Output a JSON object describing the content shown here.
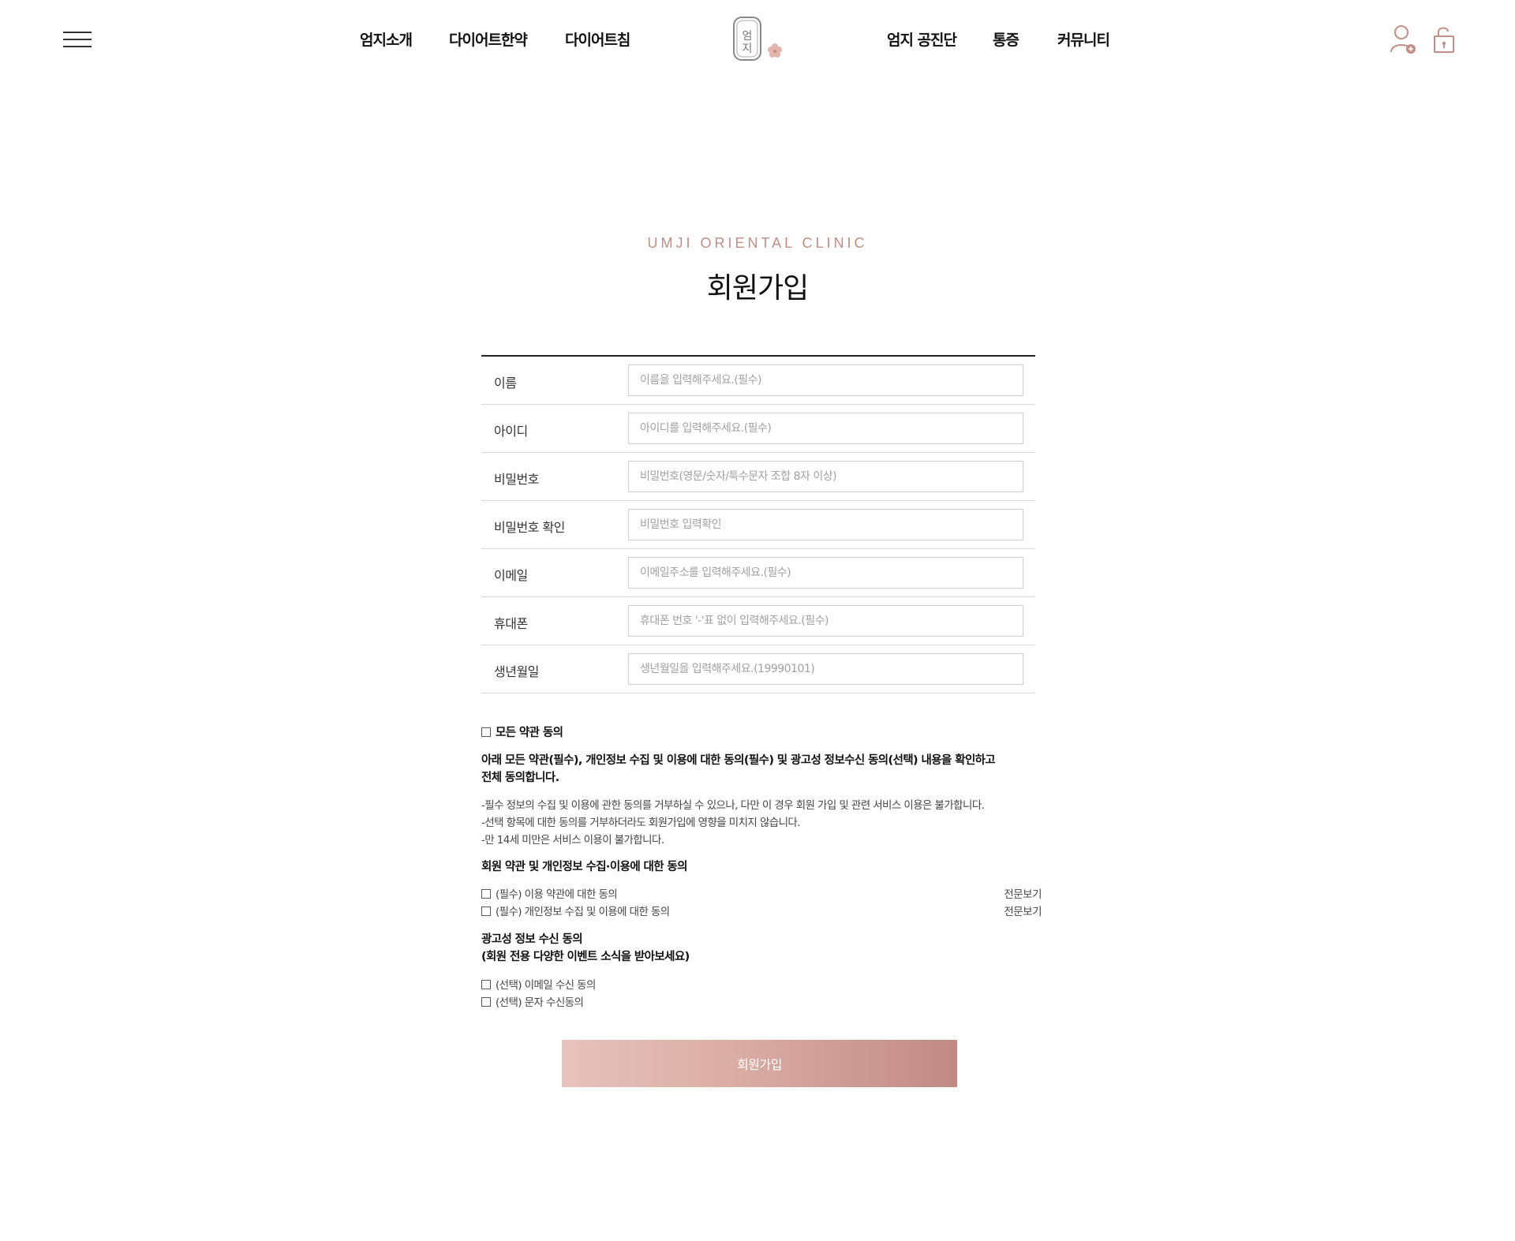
{
  "nav": {
    "left_items": [
      "엄지소개",
      "다이어트한약",
      "다이어트침"
    ],
    "right_items": [
      "엄지 공진단",
      "통증",
      "커뮤니티"
    ],
    "logo_text": "엄지"
  },
  "icons": {
    "menu": "hamburger-menu-icon",
    "join": "user-add-icon",
    "login": "lock-icon",
    "accent_color": "#c28e86"
  },
  "page": {
    "subtitle": "UMJI ORIENTAL CLINIC",
    "title": "회원가입"
  },
  "form": {
    "fields": [
      {
        "label": "이름",
        "placeholder": "이름을 입력해주세요.(필수)"
      },
      {
        "label": "아이디",
        "placeholder": "아이디를 입력해주세요.(필수)"
      },
      {
        "label": "비밀번호",
        "placeholder": "비밀번호(영문/숫자/특수문자 조합 8자 이상)"
      },
      {
        "label": "비밀번호 확인",
        "placeholder": "비밀번호 입력확인"
      },
      {
        "label": "이메일",
        "placeholder": "이메일주소를 입력해주세요.(필수)"
      },
      {
        "label": "휴대폰",
        "placeholder": "휴대폰 번호 '-'표 없이 입력해주세요.(필수)"
      },
      {
        "label": "생년월일",
        "placeholder": "생년월일을 입력해주세요.(19990101)"
      }
    ]
  },
  "agreement": {
    "all_label": "모든 약관 동의",
    "intro_line1": "아래 모든 약관(필수), 개인정보 수집 및 이용에 대한 동의(필수) 및 광고성 정보수신 동의(선택) 내용을 확인하고",
    "intro_line2": "전체 동의합니다.",
    "notes": [
      "-필수 정보의 수집 및 이용에 관한 동의를 거부하실 수 있으나, 다만 이 경우 회원 가입 및 관련 서비스 이용은 불가합니다.",
      "-선택 항목에 대한 동의를 거부하더라도 회원가입에 영향을 미치지 않습니다.",
      "-만 14세 미만은 서비스 이용이 불가합니다."
    ],
    "terms_heading": "회원 약관 및 개인정보 수집·이용에 대한 동의",
    "terms_items": [
      {
        "label": "(필수) 이용 약관에 대한 동의",
        "link": "전문보기"
      },
      {
        "label": "(필수) 개인정보 수집 및 이용에 대한 동의",
        "link": "전문보기"
      }
    ],
    "ad_heading_line1": "광고성 정보 수신 동의",
    "ad_heading_line2": "(회원 전용 다양한 이벤트 소식을 받아보세요)",
    "ad_items": [
      "(선택) 이메일 수신 동의",
      "(선택) 문자 수신동의"
    ]
  },
  "submit_label": "회원가입"
}
